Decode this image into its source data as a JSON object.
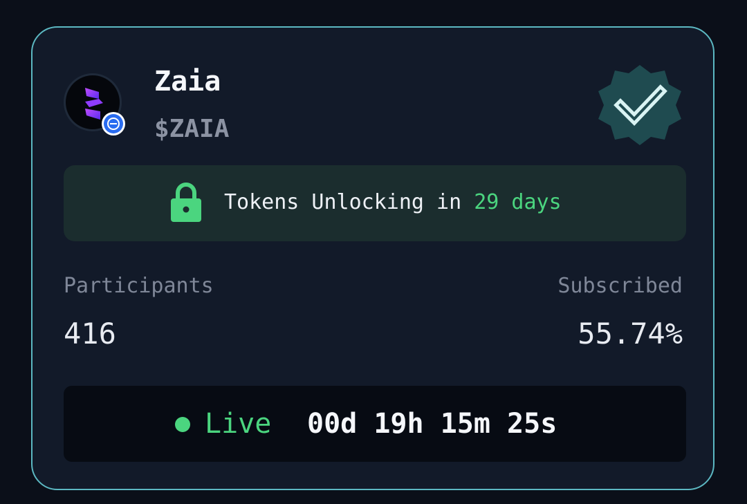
{
  "project": {
    "name": "Zaia",
    "ticker": "$ZAIA",
    "verified": true
  },
  "unlock": {
    "prefix": "Tokens Unlocking in ",
    "days": "29 days"
  },
  "stats": {
    "participants_label": "Participants",
    "participants_value": "416",
    "subscribed_label": "Subscribed",
    "subscribed_value": "55.74%"
  },
  "status": {
    "live_label": "Live",
    "countdown": {
      "days": "00d",
      "hours": "19h",
      "minutes": "15m",
      "seconds": "25s"
    }
  },
  "icons": {
    "avatar": "zaia-logo-icon",
    "chain": "chain-badge-icon",
    "verified": "verified-badge-icon",
    "lock": "lock-icon"
  },
  "colors": {
    "accent_green": "#4bd57f",
    "card_border": "#5cb8c2",
    "card_bg": "#121a29",
    "verified_badge": "#1f4b50",
    "chain_badge": "#2a6cf0"
  }
}
